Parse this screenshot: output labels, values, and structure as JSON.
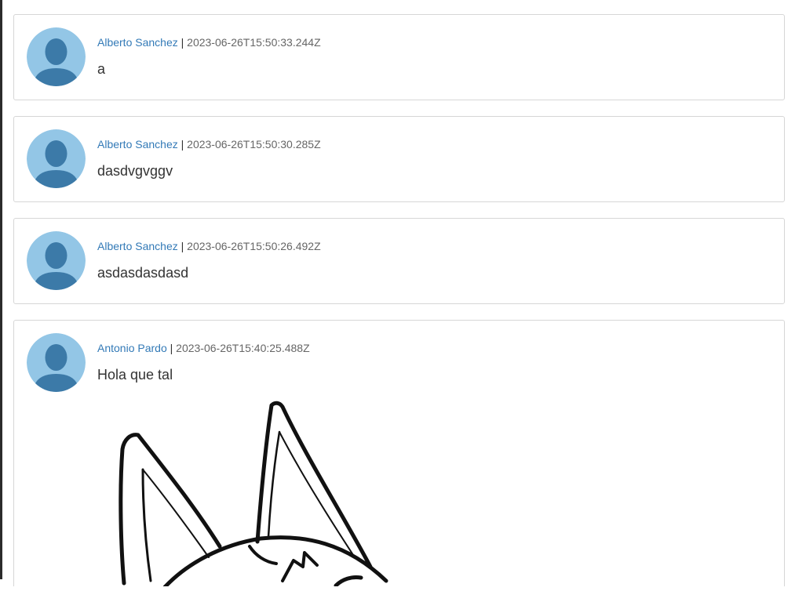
{
  "posts": [
    {
      "author": "Alberto Sanchez",
      "separator": "|",
      "timestamp": "2023-06-26T15:50:33.244Z",
      "text": "a"
    },
    {
      "author": "Alberto Sanchez",
      "separator": "|",
      "timestamp": "2023-06-26T15:50:30.285Z",
      "text": "dasdvgvggv"
    },
    {
      "author": "Alberto Sanchez",
      "separator": "|",
      "timestamp": "2023-06-26T15:50:26.492Z",
      "text": "asdasdasdasd"
    },
    {
      "author": "Antonio Pardo",
      "separator": "|",
      "timestamp": "2023-06-26T15:40:25.488Z",
      "text": "Hola que tal",
      "attachment": "cat-line-drawing"
    }
  ],
  "colors": {
    "author_link": "#337ab7",
    "avatar_bg": "#93c6e6",
    "avatar_figure": "#3c7aa8",
    "card_border": "#d6d6d6"
  }
}
